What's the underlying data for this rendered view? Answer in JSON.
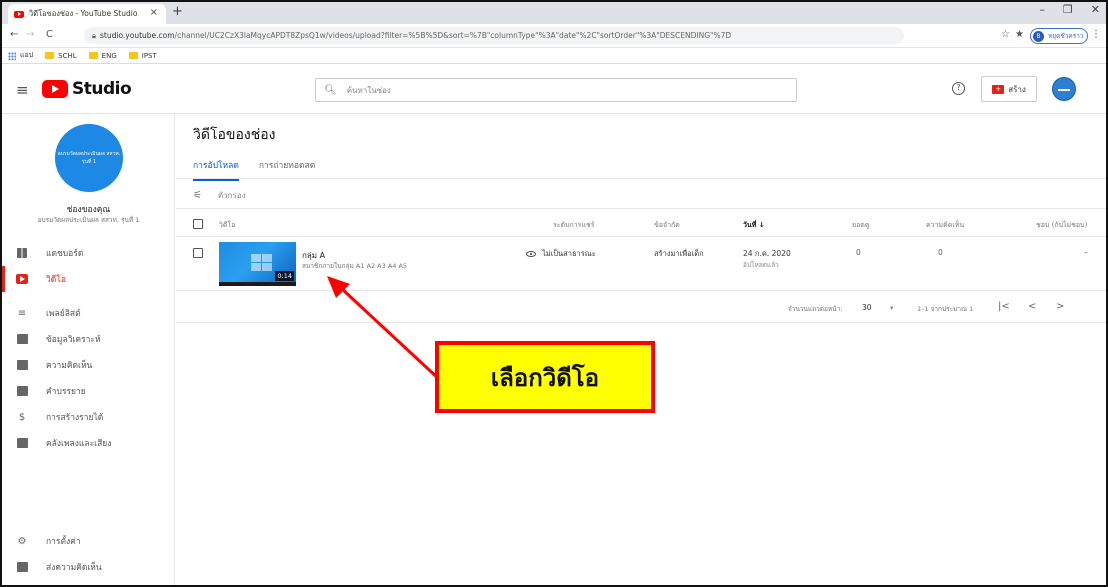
{
  "browser": {
    "tab_title": "วิดีโอของช่อง - YouTube Studio",
    "tab_close": "×",
    "new_tab": "+",
    "window_controls": [
      "–",
      "❐",
      "✕"
    ],
    "nav": {
      "back": "←",
      "forward": "→",
      "reload": "C"
    },
    "url_host": "studio.youtube.com",
    "url_path": "/channel/UC2CzX3laMqycAPDT8ZpsQ1w/videos/upload?filter=%5B%5D&sort=%7B\"columnType\"%3A\"date\"%2C\"sortOrder\"%3A\"DESCENDING\"%7D",
    "star": "☆",
    "extension": "★",
    "profile_label": "หยุดชั่วคราว",
    "profile_initial": "B",
    "menu": "⋮",
    "bookmarks": {
      "apps_label": "แอป",
      "items": [
        "SCHL",
        "ENG",
        "IPST"
      ]
    }
  },
  "studio_header": {
    "menu_icon": "≡",
    "logo_text": "Studio",
    "search_placeholder": "ค้นหาในช่อง",
    "help_icon": "?",
    "create_label": "สร้าง",
    "create_icon": "+"
  },
  "sidebar": {
    "channel_avatar_line1": "อบรมวัดผลประเมินผล สสวท.",
    "channel_avatar_line2": "รุ่นที่ 1",
    "channel_title": "ช่องของคุณ",
    "channel_subtitle": "อบรมวัดผลประเมินผล สสวท. รุ่นที่ 1",
    "items": [
      {
        "label": "แดชบอร์ด",
        "icon": "dashboard-icon"
      },
      {
        "label": "วิดีโอ",
        "icon": "videos-icon",
        "active": true
      },
      {
        "label": "เพลย์ลิสต์",
        "icon": "playlists-icon"
      },
      {
        "label": "ข้อมูลวิเคราะห์",
        "icon": "analytics-icon"
      },
      {
        "label": "ความคิดเห็น",
        "icon": "comments-icon"
      },
      {
        "label": "คำบรรยาย",
        "icon": "subtitles-icon"
      },
      {
        "label": "การสร้างรายได้",
        "icon": "monetization-icon"
      },
      {
        "label": "คลังเพลงและเสียง",
        "icon": "audio-library-icon"
      }
    ],
    "bottom_items": [
      {
        "label": "การตั้งค่า",
        "icon": "settings-icon"
      },
      {
        "label": "ส่งความคิดเห็น",
        "icon": "feedback-icon"
      }
    ]
  },
  "main": {
    "title": "วิดีโอของช่อง",
    "tabs": [
      "การอัปโหลด",
      "การถ่ายทอดสด"
    ],
    "active_tab": "การอัปโหลด",
    "filter_placeholder": "ตัวกรอง",
    "columns": {
      "video": "วิดีโอ",
      "visibility": "ระดับการแชร์",
      "restrictions": "ข้อจำกัด",
      "date": "วันที่ ↓",
      "views": "ยอดดู",
      "comments": "ความคิดเห็น",
      "likes": "ชอบ (กับไม่ชอบ)"
    },
    "rows": [
      {
        "title": "กลุ่ม A",
        "description": "สมาชิกภายในกลุ่ม A1 A2 A3 A4 A5",
        "duration": "0:14",
        "visibility": "ไม่เป็นสาธารณะ",
        "restrictions": "สร้างมาเพื่อเด็ก",
        "date": "24 ก.ค. 2020",
        "date_status": "อัปโหลดแล้ว",
        "views": "0",
        "comments": "0",
        "likes": "–"
      }
    ],
    "pager": {
      "rows_per_page_label": "จำนวนแถวต่อหน้า:",
      "rows_per_page": "30",
      "dropdown": "▾",
      "range": "1–1 จากประมาณ 1",
      "first": "|<",
      "prev": "<",
      "next": ">"
    }
  },
  "annotation": {
    "callout_text": "เลือกวิดีโอ",
    "arrow_color": "#ff0000",
    "box_fill": "#ffff00"
  }
}
